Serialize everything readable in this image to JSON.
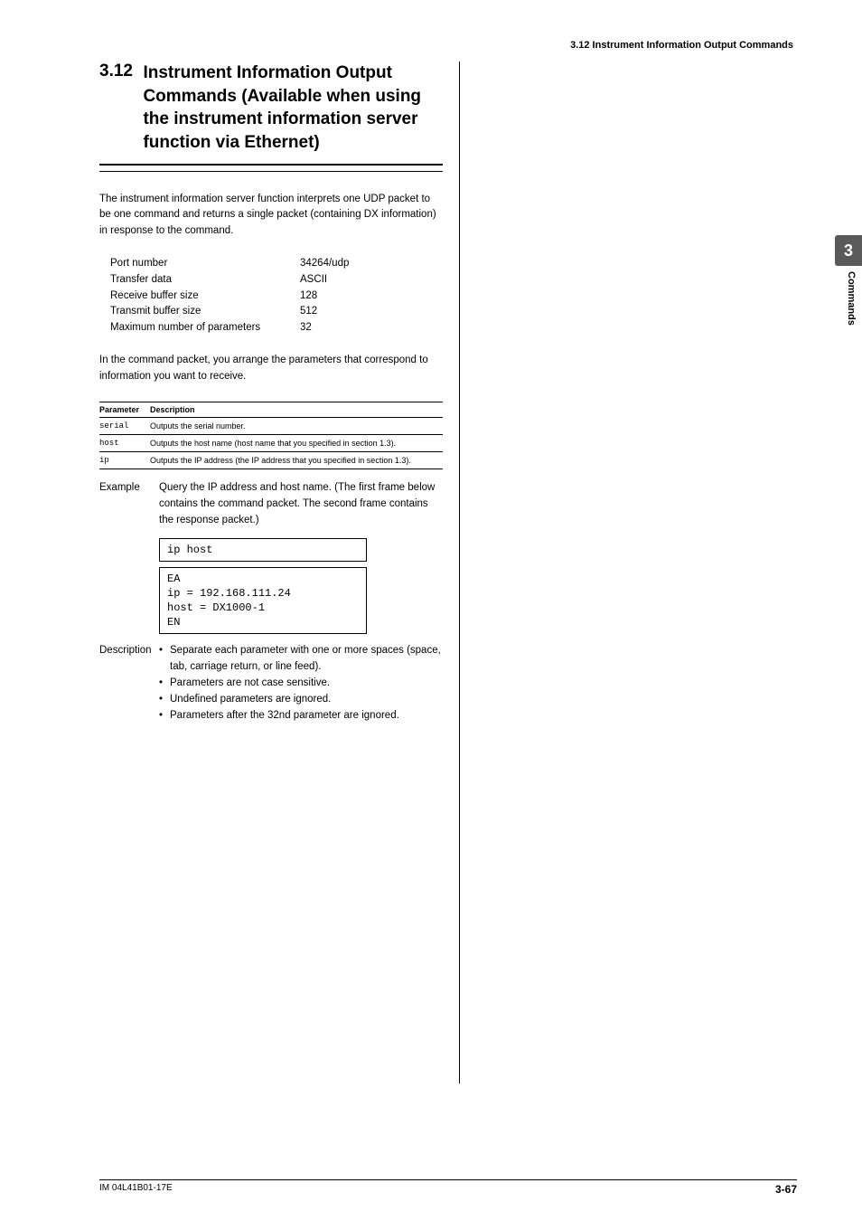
{
  "running_header": "3.12  Instrument Information Output Commands",
  "section": {
    "number": "3.12",
    "title": "Instrument Information Output Commands (Available when using the instrument information server function via Ethernet)"
  },
  "intro_para": "The instrument information server function interprets one UDP packet to be one command and returns a single packet (containing DX information) in response to the command.",
  "kv": [
    {
      "k": "Port number",
      "v": "34264/udp"
    },
    {
      "k": "Transfer data",
      "v": "ASCII"
    },
    {
      "k": "Receive buffer size",
      "v": "128"
    },
    {
      "k": "Transmit buffer size",
      "v": "512"
    },
    {
      "k": "Maximum number of parameters",
      "v": "32"
    }
  ],
  "para2": "In the command packet, you arrange the parameters that correspond to information you want to receive.",
  "param_header": {
    "c1": "Parameter",
    "c2": "Description"
  },
  "params": [
    {
      "p": "serial",
      "d": "Outputs the serial number."
    },
    {
      "p": "host",
      "d": "Outputs the host name (host name that you specified in section 1.3)."
    },
    {
      "p": "ip",
      "d": "Outputs the IP address (the IP address that you specified in section 1.3)."
    }
  ],
  "example_label": "Example",
  "example_text": "Query the IP address and host name. (The first frame below contains the command packet. The second frame contains the response packet.)",
  "frame1": "ip host",
  "frame2": "EA\nip = 192.168.111.24\nhost = DX1000-1\nEN",
  "description_label": "Description",
  "desc_items": [
    "Separate each parameter with one or more spaces (space, tab, carriage return, or line feed).",
    "Parameters are not case sensitive.",
    "Undefined parameters are ignored.",
    "Parameters after the 32nd parameter are ignored."
  ],
  "tab_number": "3",
  "tab_label": "Commands",
  "footer_left": "IM 04L41B01-17E",
  "footer_right": "3-67"
}
